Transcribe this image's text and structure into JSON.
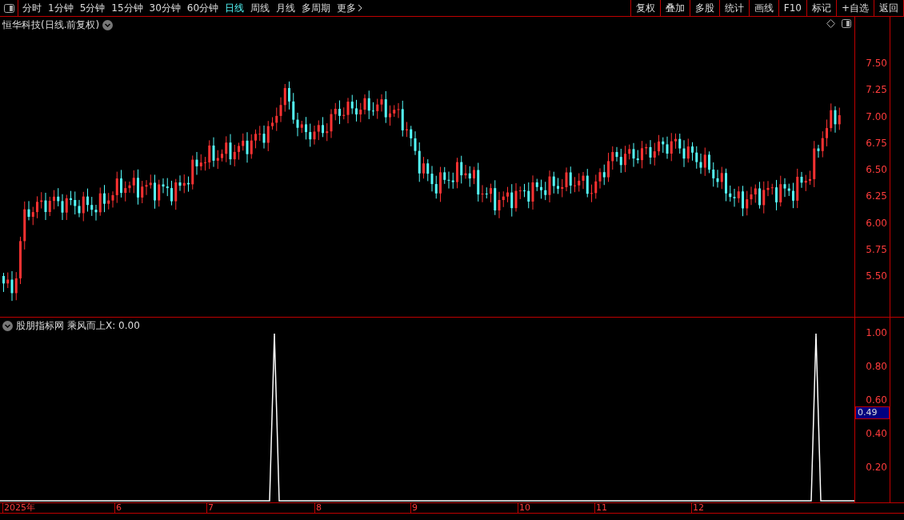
{
  "toolbar": {
    "periods": [
      {
        "label": "分时",
        "selected": false
      },
      {
        "label": "1分钟",
        "selected": false
      },
      {
        "label": "5分钟",
        "selected": false
      },
      {
        "label": "15分钟",
        "selected": false
      },
      {
        "label": "30分钟",
        "selected": false
      },
      {
        "label": "60分钟",
        "selected": false
      },
      {
        "label": "日线",
        "selected": true
      },
      {
        "label": "周线",
        "selected": false
      },
      {
        "label": "月线",
        "selected": false
      },
      {
        "label": "多周期",
        "selected": false
      },
      {
        "label": "更多",
        "selected": false
      }
    ],
    "actions": [
      "复权",
      "叠加",
      "多股",
      "统计",
      "画线",
      "F10",
      "标记",
      "+自选",
      "返回"
    ]
  },
  "main_chart": {
    "title": "恒华科技(日线.前复权)",
    "price_axis": [
      "7.50",
      "7.25",
      "7.00",
      "6.75",
      "6.50",
      "6.25",
      "6.00",
      "5.75",
      "5.50"
    ]
  },
  "indicator": {
    "name": "股朋指标网",
    "formula": "乘风而上X: 0.00",
    "axis": [
      "1.00",
      "0.80",
      "0.60",
      "0.40",
      "0.20"
    ],
    "cursor_value": "0.49"
  },
  "date_axis": [
    "2025年",
    "6",
    "7",
    "8",
    "9",
    "10",
    "11",
    "12"
  ]
}
